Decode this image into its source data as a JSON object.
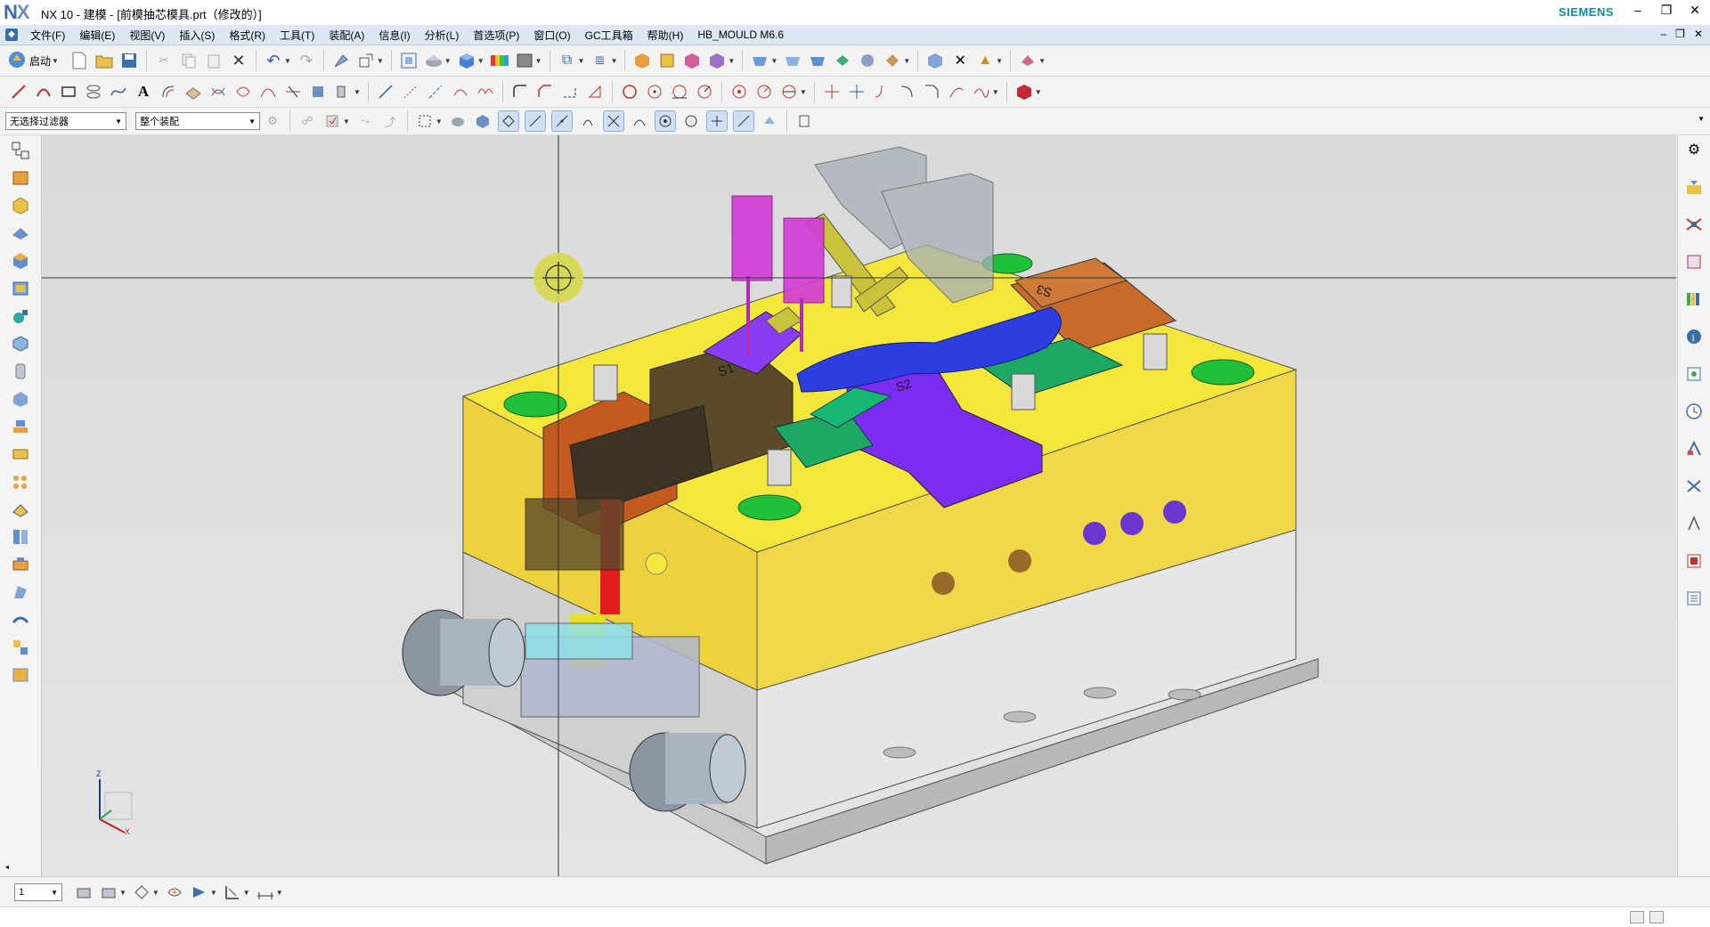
{
  "titlebar": {
    "logo_n": "N",
    "logo_x": "X",
    "title": "NX 10 - 建模 - [前模抽芯模具.prt（修改的）]",
    "brand": "SIEMENS",
    "minimize": "–",
    "restore": "❐",
    "close": "✕"
  },
  "menu": {
    "items": [
      "文件(F)",
      "编辑(E)",
      "视图(V)",
      "插入(S)",
      "格式(R)",
      "工具(T)",
      "装配(A)",
      "信息(I)",
      "分析(L)",
      "首选项(P)",
      "窗口(O)",
      "GC工具箱",
      "帮助(H)",
      "HB_MOULD M6.6"
    ],
    "doc_minimize": "–",
    "doc_restore": "❐",
    "doc_close": "✕"
  },
  "toolbar": {
    "start_label": "启动",
    "selection_filter": "无选择过滤器",
    "assembly_scope": "整个装配"
  },
  "bottombar": {
    "layer_value": "1"
  },
  "graphics": {
    "slider_labels": [
      "S1",
      "S2",
      "S3"
    ],
    "triad": {
      "z": "Z",
      "x": "X"
    }
  },
  "colors": {
    "plate_yellow": "#f2dc3c",
    "a_plate_side": "#e9c93a",
    "base_gray": "#d9d9d9",
    "slider_dark": "#4a3d22",
    "slider_purple": "#7c2cf0",
    "core_blue": "#2d3ee0",
    "green_insert": "#1fa864",
    "orange_block": "#c85a1e",
    "magenta": "#d43ad8",
    "olive": "#c9c23a",
    "translucent_gray": "#a7b0b8",
    "menu_bg": "#dce8f4"
  }
}
